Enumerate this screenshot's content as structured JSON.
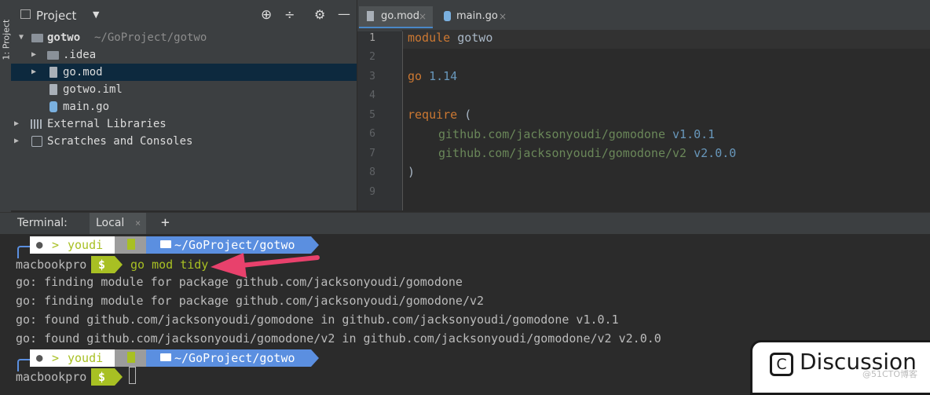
{
  "toolstrip": {
    "label": "1: Project"
  },
  "project_panel": {
    "title": "Project",
    "tree": [
      {
        "name": "gotwo",
        "path": "~/GoProject/gotwo"
      },
      {
        "name": ".idea"
      },
      {
        "name": "go.mod"
      },
      {
        "name": "gotwo.iml"
      },
      {
        "name": "main.go"
      },
      {
        "name": "External Libraries"
      },
      {
        "name": "Scratches and Consoles"
      }
    ]
  },
  "editor": {
    "tabs": [
      {
        "label": "go.mod",
        "close": "×"
      },
      {
        "label": "main.go",
        "close": "×"
      }
    ],
    "line_numbers": [
      "1",
      "2",
      "3",
      "4",
      "5",
      "6",
      "7",
      "8",
      "9"
    ],
    "code": {
      "l1_kw": "module",
      "l1_rest": " gotwo",
      "l3_kw": "go",
      "l3_num": " 1.14",
      "l5_kw": "require",
      "l5_rest": " (",
      "l6_mod": "github.com/jacksonyoudi/gomodone",
      "l6_ver": " v1.0.1",
      "l7_mod": "github.com/jacksonyoudi/gomodone/v2",
      "l7_ver": " v2.0.0",
      "l8": ")"
    }
  },
  "terminal": {
    "label": "Terminal:",
    "tab": "Local",
    "tab_close": "×",
    "add": "+",
    "prompt_user": "youdi",
    "prompt_path": "~/GoProject/gotwo",
    "host": "macbookpro",
    "dollar": "$",
    "command": "go mod tidy",
    "output": [
      "go: finding module for package github.com/jacksonyoudi/gomodone",
      "go: finding module for package github.com/jacksonyoudi/gomodone/v2",
      "go: found github.com/jacksonyoudi/gomodone in github.com/jacksonyoudi/gomodone v1.0.1",
      "go: found github.com/jacksonyoudi/gomodone/v2 in github.com/jacksonyoudi/gomodone/v2 v2.0.0"
    ]
  },
  "overlay": {
    "discussion": "Discussion",
    "watermark": "@51CTO博客"
  },
  "colors": {
    "accent_arrow": "#e8416c",
    "prompt_green": "#a8c023",
    "prompt_blue": "#5b8fe0"
  }
}
